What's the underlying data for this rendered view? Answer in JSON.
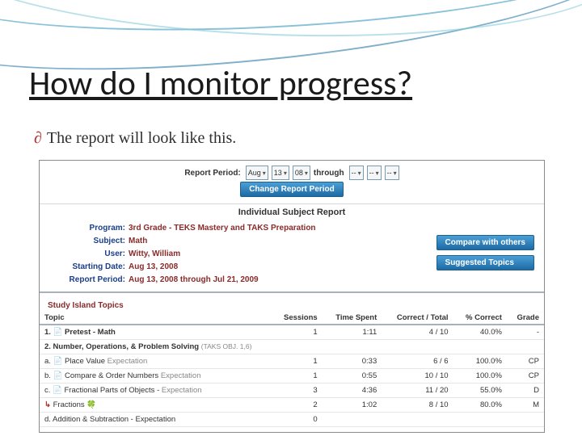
{
  "slide": {
    "title": "How do I monitor progress?",
    "subtitle": "The report will look like this."
  },
  "filters": {
    "label_period": "Report Period:",
    "month": "Aug",
    "day": "13",
    "year": "08",
    "through": "through",
    "m2": "--",
    "d2": "--",
    "y2": "--",
    "change_btn": "Change Report Period"
  },
  "report": {
    "title": "Individual Subject Report",
    "labels": {
      "program": "Program:",
      "subject": "Subject:",
      "user": "User:",
      "start": "Starting Date:",
      "period": "Report Period:"
    },
    "values": {
      "program": "3rd Grade - TEKS Mastery and TAKS Preparation",
      "subject": "Math",
      "user": "Witty, William",
      "start": "Aug 13, 2008",
      "period": "Aug 13, 2008 through Jul 21, 2009"
    },
    "side": {
      "compare": "Compare with others",
      "suggest": "Suggested Topics"
    }
  },
  "section": "Study Island Topics",
  "cols": {
    "topic": "Topic",
    "sessions": "Sessions",
    "time": "Time Spent",
    "correct": "Correct / Total",
    "pct": "% Correct",
    "grade": "Grade"
  },
  "rows": {
    "pretest": "1. 📄 Pretest - Math",
    "strand": "2. Number, Operations, & Problem Solving",
    "taks": "(TAKS OBJ. 1,6)",
    "a": "a. 📄 Place Value",
    "b": "b. 📄 Compare & Order Numbers",
    "c": "c. 📄 Fractional Parts of Objects",
    "c_sub": "Fractions 🍀",
    "d": "d. Addition & Subtraction",
    "exp": "Expectation",
    "r1": {
      "s": "1",
      "t": "1:11",
      "ct": "4 / 10",
      "p": "40.0%",
      "g": "-"
    },
    "r_a": {
      "s": "1",
      "t": "0:33",
      "ct": "6 / 6",
      "p": "100.0%",
      "g": "CP"
    },
    "r_b": {
      "s": "1",
      "t": "0:55",
      "ct": "10 / 10",
      "p": "100.0%",
      "g": "CP"
    },
    "r_c": {
      "s": "3",
      "t": "4:36",
      "ct": "11 / 20",
      "p": "55.0%",
      "g": "D"
    },
    "r_cs": {
      "s": "2",
      "t": "1:02",
      "ct": "8 / 10",
      "p": "80.0%",
      "g": "M"
    },
    "r_d": {
      "s": "0",
      "t": "",
      "ct": "",
      "p": "",
      "g": ""
    }
  },
  "chart_data": {
    "type": "table",
    "title": "Individual Subject Report — Study Island Topics",
    "columns": [
      "Topic",
      "Sessions",
      "Time Spent (m:ss)",
      "Correct",
      "Total",
      "% Correct",
      "Grade"
    ],
    "rows": [
      [
        "1. Pretest - Math",
        1,
        "1:11",
        4,
        10,
        40.0,
        "-"
      ],
      [
        "2a. Place Value",
        1,
        "0:33",
        6,
        6,
        100.0,
        "CP"
      ],
      [
        "2b. Compare & Order Numbers",
        1,
        "0:55",
        10,
        10,
        100.0,
        "CP"
      ],
      [
        "2c. Fractional Parts of Objects",
        3,
        "4:36",
        11,
        20,
        55.0,
        "D"
      ],
      [
        "2c → Fractions",
        2,
        "1:02",
        8,
        10,
        80.0,
        "M"
      ],
      [
        "2d. Addition & Subtraction",
        0,
        null,
        null,
        null,
        null,
        null
      ]
    ]
  }
}
